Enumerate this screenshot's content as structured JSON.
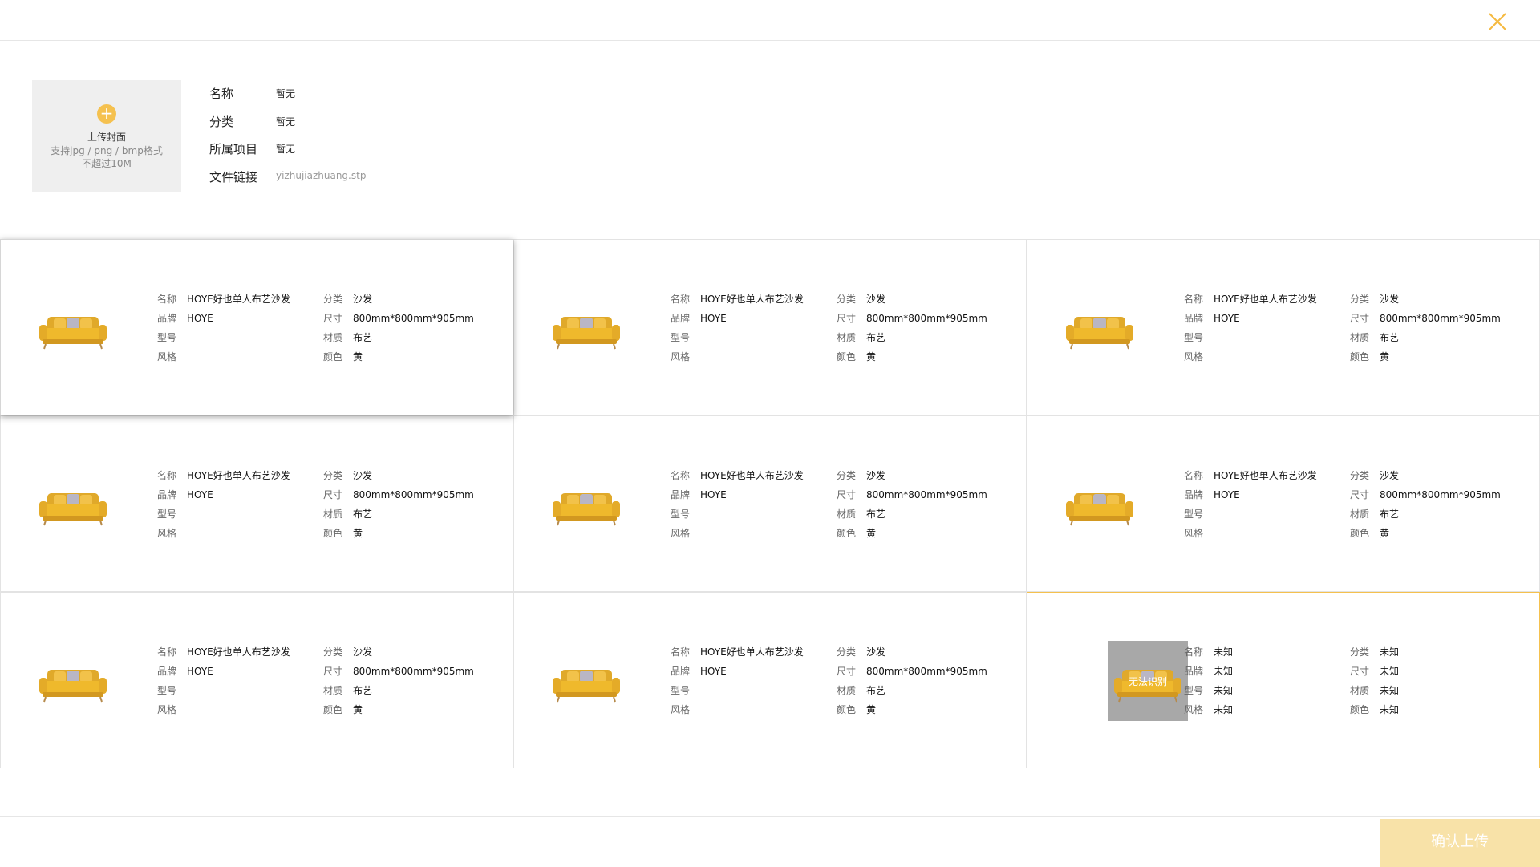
{
  "upload": {
    "title": "上传封面",
    "hint_line1": "支持jpg / png / bmp格式",
    "hint_line2": "不超过10M"
  },
  "file_info": [
    {
      "label": "名称",
      "value": "暂无"
    },
    {
      "label": "分类",
      "value": "暂无"
    },
    {
      "label": "所属项目",
      "value": "暂无"
    },
    {
      "label": "文件链接",
      "value": "yizhujiazhuang.stp"
    }
  ],
  "field_labels": {
    "name": "名称",
    "brand": "品牌",
    "model": "型号",
    "style": "风格",
    "category": "分类",
    "size": "尺寸",
    "material": "材质",
    "color": "颜色"
  },
  "items": [
    {
      "name": "HOYE好也单人布艺沙发",
      "brand": "HOYE",
      "model": "",
      "style": "",
      "category": "沙发",
      "size": "800mm*800mm*905mm",
      "material": "布艺",
      "color": "黄"
    },
    {
      "name": "HOYE好也单人布艺沙发",
      "brand": "HOYE",
      "model": "",
      "style": "",
      "category": "沙发",
      "size": "800mm*800mm*905mm",
      "material": "布艺",
      "color": "黄"
    },
    {
      "name": "HOYE好也单人布艺沙发",
      "brand": "HOYE",
      "model": "",
      "style": "",
      "category": "沙发",
      "size": "800mm*800mm*905mm",
      "material": "布艺",
      "color": "黄"
    },
    {
      "name": "HOYE好也单人布艺沙发",
      "brand": "HOYE",
      "model": "",
      "style": "",
      "category": "沙发",
      "size": "800mm*800mm*905mm",
      "material": "布艺",
      "color": "黄"
    },
    {
      "name": "HOYE好也单人布艺沙发",
      "brand": "HOYE",
      "model": "",
      "style": "",
      "category": "沙发",
      "size": "800mm*800mm*905mm",
      "material": "布艺",
      "color": "黄"
    },
    {
      "name": "HOYE好也单人布艺沙发",
      "brand": "HOYE",
      "model": "",
      "style": "",
      "category": "沙发",
      "size": "800mm*800mm*905mm",
      "material": "布艺",
      "color": "黄"
    },
    {
      "name": "HOYE好也单人布艺沙发",
      "brand": "HOYE",
      "model": "",
      "style": "",
      "category": "沙发",
      "size": "800mm*800mm*905mm",
      "material": "布艺",
      "color": "黄"
    },
    {
      "name": "HOYE好也单人布艺沙发",
      "brand": "HOYE",
      "model": "",
      "style": "",
      "category": "沙发",
      "size": "800mm*800mm*905mm",
      "material": "布艺",
      "color": "黄"
    },
    {
      "name": "未知",
      "brand": "未知",
      "model": "未知",
      "style": "未知",
      "category": "未知",
      "size": "未知",
      "material": "未知",
      "color": "未知",
      "thumb_overlay": "无法识别"
    }
  ],
  "footer": {
    "confirm_label": "确认上传"
  },
  "colors": {
    "accent": "#f5c14f",
    "confirm_bg": "#f8e2a8",
    "failed_thumb_bg": "#a8a8a8"
  },
  "icons": {
    "close": "close-icon",
    "plus": "plus-icon",
    "sofa": "sofa-image"
  }
}
